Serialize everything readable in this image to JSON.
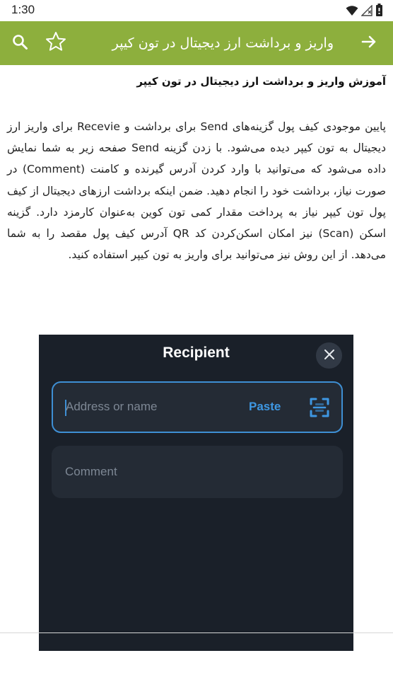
{
  "status_bar": {
    "time": "1:30"
  },
  "app_bar": {
    "title": "واریز و برداشت ارز دیجیتال در تون کیپر"
  },
  "article": {
    "heading": "آموزش واریز و برداشت ارز دیجیتال در تون کیپر",
    "paragraph": "پایین موجودی کیف پول گزینه‌های Send برای برداشت و Recevie برای واریز ارز دیجیتال به تون کیپر دیده می‌شود. با زدن گزینه Send صفحه زیر به شما نمایش داده می‌شود که می‌توانید با وارد کردن آدرس گیرنده و کامنت (Comment) در صورت نیاز، برداشت خود را انجام دهید. ضمن اینکه برداشت ارزهای دیجیتال از کیف پول تون کیپر نیاز به پرداخت مقدار کمی تون کوین به‌عنوان کارمزد دارد. گزینه اسکن (Scan) نیز امکان اسکن‌کردن کد QR آدرس کیف پول مقصد را به شما می‌دهد. از این روش نیز می‌توانید برای واریز به تون کیپر استفاده کنید."
  },
  "embedded_screenshot": {
    "title": "Recipient",
    "address_placeholder": "Address or name",
    "paste_label": "Paste",
    "comment_placeholder": "Comment"
  },
  "colors": {
    "app_bar": "#8daf3d",
    "shot_background": "#1a2029",
    "field_background": "#242b35",
    "accent_blue": "#3e8fd4"
  },
  "icons": [
    "wifi-icon",
    "cell-signal-icon",
    "battery-icon",
    "arrow-forward-icon",
    "star-outline-icon",
    "search-icon",
    "close-icon",
    "scan-icon"
  ]
}
